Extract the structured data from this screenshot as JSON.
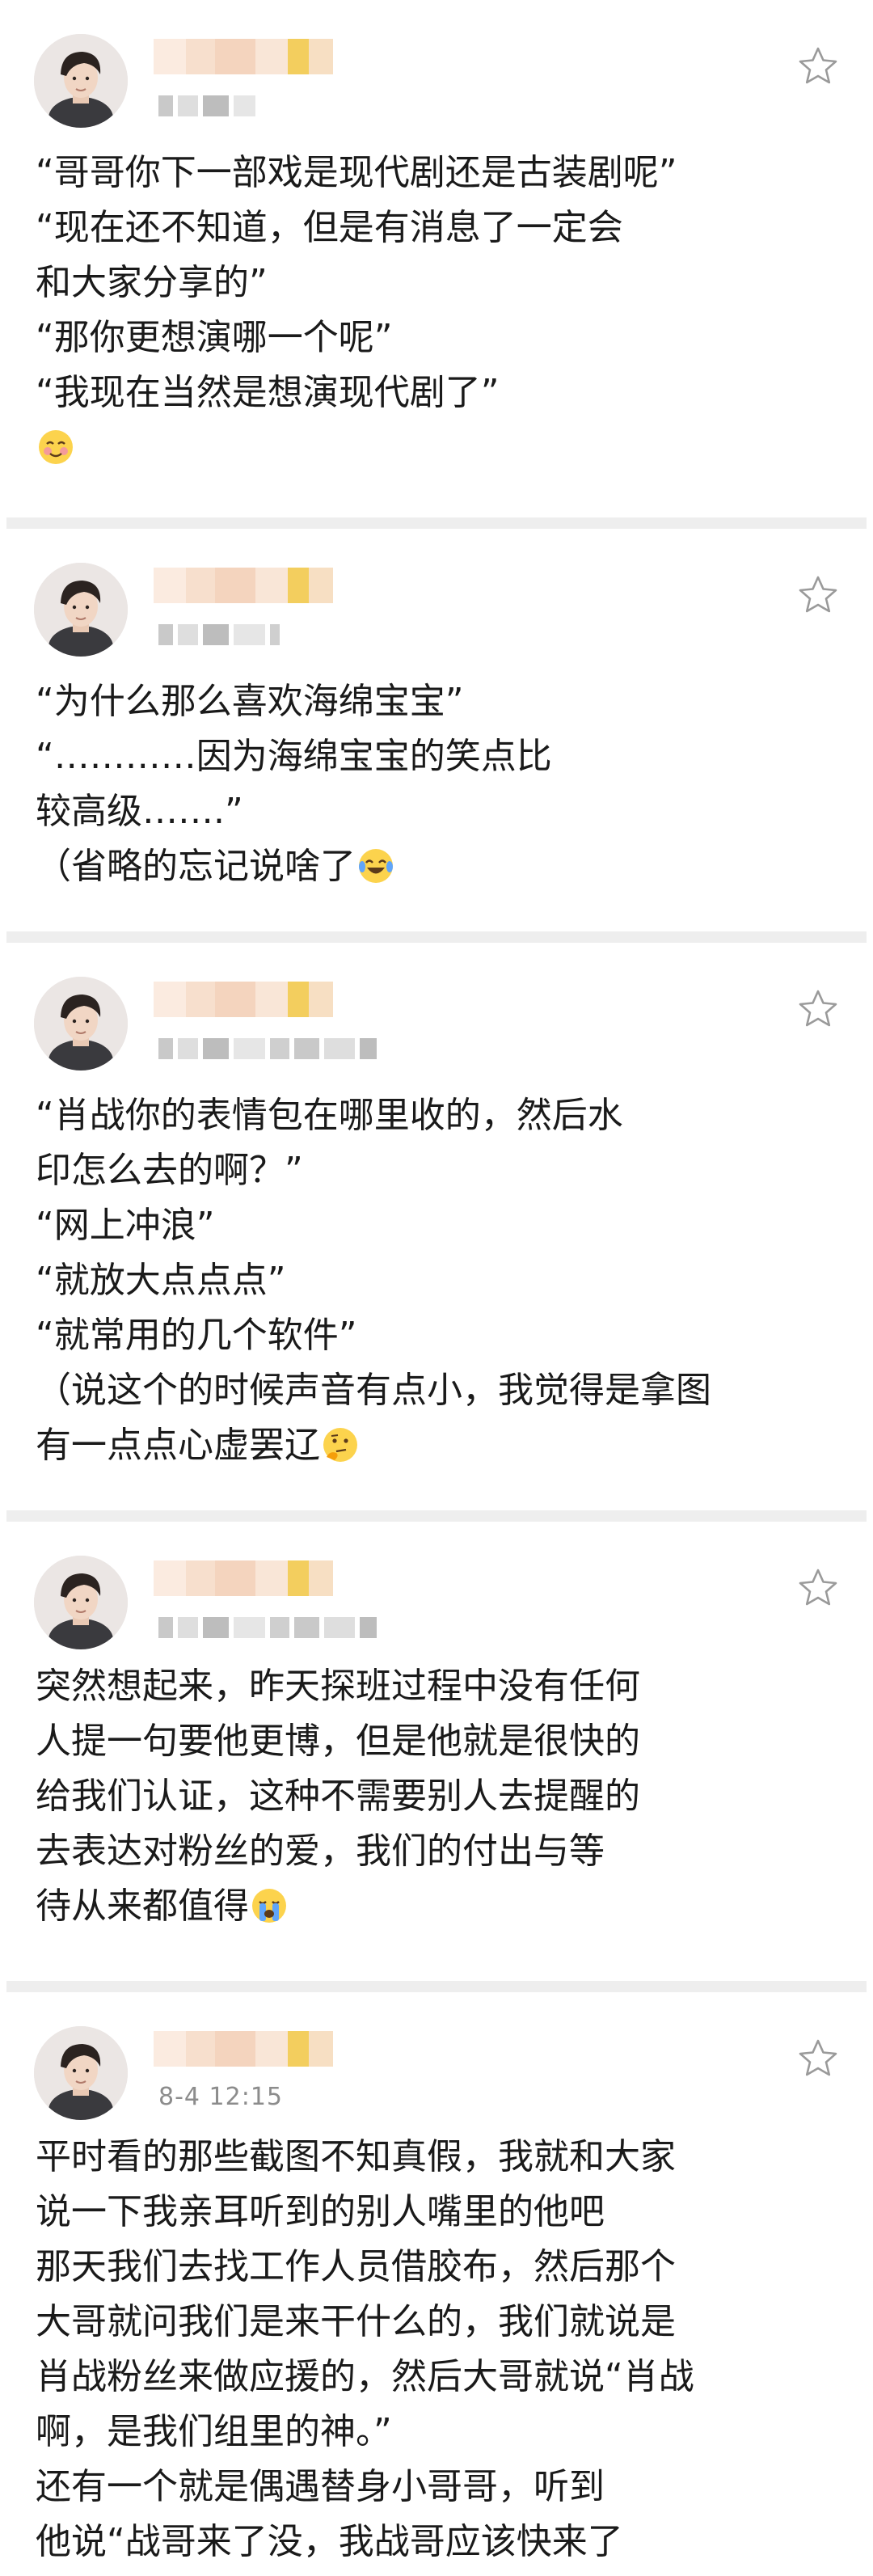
{
  "posts": [
    {
      "meta": "",
      "lines": [
        "“哥哥你下一部戏是现代剧还是古装剧呢”",
        "“现在还不知道，但是有消息了一定会",
        "和大家分享的”",
        "“那你更想演哪一个呢”",
        "“我现在当然是想演现代剧了”"
      ],
      "trailing_emoji": "blushing-face-emoji"
    },
    {
      "meta": "",
      "lines": [
        "“为什么那么喜欢海绵宝宝”",
        "“…………因为海绵宝宝的笑点比",
        "较高级…….”",
        "（省略的忘记说啥了"
      ],
      "trailing_emoji": "laughing-crying-emoji"
    },
    {
      "meta": "",
      "lines": [
        "“肖战你的表情包在哪里收的，然后水",
        "印怎么去的啊？”",
        "“网上冲浪”",
        "“就放大点点点”",
        "“就常用的几个软件”",
        "（说这个的时候声音有点小，我觉得是拿图",
        "有一点点心虚罢辽"
      ],
      "trailing_emoji": "thinking-face-emoji"
    },
    {
      "meta": "",
      "lines": [
        "突然想起来，昨天探班过程中没有任何",
        "人提一句要他更博，但是他就是很快的",
        "给我们认证，这种不需要别人去提醒的",
        "去表达对粉丝的爱，我们的付出与等",
        "待从来都值得"
      ],
      "trailing_emoji": "loudly-crying-emoji"
    },
    {
      "meta": "8-4 12:15",
      "lines": [
        "平时看的那些截图不知真假，我就和大家",
        "说一下我亲耳听到的别人嘴里的他吧",
        "那天我们去找工作人员借胶布，然后那个",
        "大哥就问我们是来干什么的，我们就说是",
        "肖战粉丝来做应援的，然后大哥就说“肖战",
        "啊，是我们组里的神。”",
        "还有一个就是偶遇替身小哥哥，听到",
        "他说“战哥来了没，我战哥应该快来了"
      ],
      "trailing_emoji": ""
    }
  ],
  "icons": {
    "favorite": "star-outline-icon",
    "avatar": "user-avatar"
  },
  "colors": {
    "background": "#ffffff",
    "divider": "#eeeeee",
    "text": "#1a1a1a",
    "meta": "#8c8c8c",
    "star_stroke": "#9a9a9a",
    "blur_gold": "#f2c94c",
    "blur_peach": "#f6dcc8"
  }
}
